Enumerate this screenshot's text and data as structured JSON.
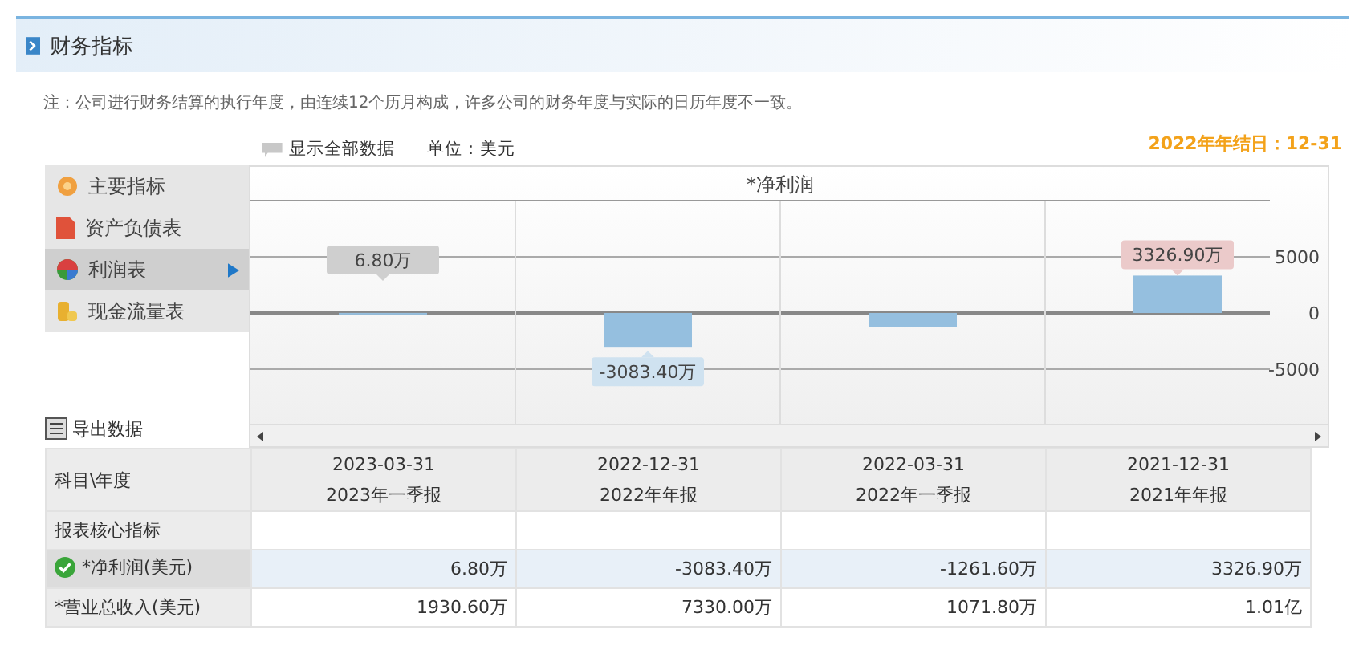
{
  "panel": {
    "title": "财务指标"
  },
  "note": "注：公司进行财务结算的执行年度，由连续12个历月构成，许多公司的财务年度与实际的日历年度不一致。",
  "legend": {
    "toggle_label": "显示全部数据",
    "unit": "单位：美元"
  },
  "year_end": "2022年年结日：12-31",
  "menu": [
    {
      "label": "主要指标",
      "selected": false
    },
    {
      "label": "资产负债表",
      "selected": false
    },
    {
      "label": "利润表",
      "selected": true
    },
    {
      "label": "现金流量表",
      "selected": false
    }
  ],
  "export_label": "导出数据",
  "chart": {
    "chart_data": {
      "type": "bar",
      "title": "*净利润",
      "values": [
        6.8,
        -3083.4,
        -1261.6,
        3326.9
      ],
      "value_labels": [
        "6.80万",
        "-3083.40万",
        null,
        "3326.90万"
      ],
      "ylim": [
        -10000,
        10000
      ],
      "yticks": [
        5000,
        0,
        -5000
      ]
    }
  },
  "table": {
    "corner": "科目\\年度",
    "columns": [
      {
        "date": "2023-03-31",
        "report": "2023年一季报"
      },
      {
        "date": "2022-12-31",
        "report": "2022年年报"
      },
      {
        "date": "2022-03-31",
        "report": "2022年一季报"
      },
      {
        "date": "2021-12-31",
        "report": "2021年年报"
      }
    ],
    "rows": [
      {
        "kind": "section",
        "label": "报表核心指标",
        "selected": false,
        "values": []
      },
      {
        "kind": "data",
        "label": "*净利润(美元)",
        "selected": true,
        "values": [
          "6.80万",
          "-3083.40万",
          "-1261.60万",
          "3326.90万"
        ]
      },
      {
        "kind": "data",
        "label": "*营业总收入(美元)",
        "selected": false,
        "values": [
          "1930.60万",
          "7330.00万",
          "1071.80万",
          "1.01亿"
        ]
      }
    ]
  }
}
